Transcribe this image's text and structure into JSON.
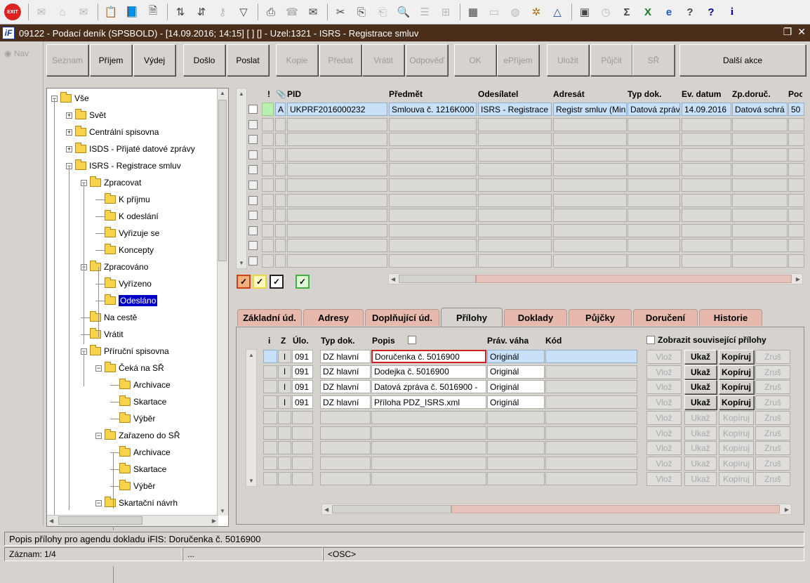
{
  "toolbar": {
    "exit_label": "EXIT",
    "icons": [
      "mail-send-icon",
      "home-icon",
      "mail-reply-icon",
      "clipboard-icon",
      "book-icon",
      "delete-doc-icon",
      "sort-az-icon",
      "sort-za-icon",
      "key-icon",
      "filter-icon",
      "printer-icon",
      "fax-icon",
      "mail-icon",
      "scissors-icon",
      "copy-icon",
      "paste-icon",
      "search-icon",
      "list-icon",
      "tree-icon",
      "calc-icon",
      "page-icon",
      "globe-icon",
      "gear-icon",
      "triangle-icon",
      "image-icon",
      "clock-icon",
      "sum-icon",
      "excel-icon",
      "ie-icon",
      "help-icon",
      "help-box-icon",
      "info-icon"
    ],
    "sum_glyph": "Σ",
    "help_glyph": "?",
    "info_glyph": "i"
  },
  "window": {
    "title": "09122 - Podací deník (SPSBOLD) - [14.09.2016; 14:15] [ ] [] - Uzel:1321 - ISRS - Registrace smluv",
    "logo": "iF"
  },
  "nav": {
    "label": "Nav"
  },
  "action_buttons": [
    {
      "label": "Seznam",
      "enabled": false
    },
    {
      "label": "Příjem",
      "enabled": true
    },
    {
      "label": "Výdej",
      "enabled": true
    },
    {
      "label": "Došlo",
      "enabled": true
    },
    {
      "label": "Poslat",
      "enabled": true
    },
    {
      "label": "Kopie",
      "enabled": false
    },
    {
      "label": "Předat",
      "enabled": false
    },
    {
      "label": "Vrátit",
      "enabled": false
    },
    {
      "label": "Odpověď",
      "enabled": false
    },
    {
      "label": "OK",
      "enabled": false
    },
    {
      "label": "ePříjem",
      "enabled": false
    },
    {
      "label": "Uložit",
      "enabled": false
    },
    {
      "label": "Půjčit",
      "enabled": false
    },
    {
      "label": "SŘ",
      "enabled": false
    },
    {
      "label": "Další akce",
      "enabled": true
    }
  ],
  "tree": [
    {
      "label": "Vše",
      "level": 0,
      "expander": "−"
    },
    {
      "label": "Svět",
      "level": 1,
      "expander": "+"
    },
    {
      "label": "Centrální spisovna",
      "level": 1,
      "expander": "+"
    },
    {
      "label": "ISDS - Přijaté datové zprávy",
      "level": 1,
      "expander": "+"
    },
    {
      "label": "ISRS - Registrace smluv",
      "level": 1,
      "expander": "−"
    },
    {
      "label": "Zpracovat",
      "level": 2,
      "expander": "−"
    },
    {
      "label": "K příjmu",
      "level": 3,
      "expander": ""
    },
    {
      "label": "K odeslání",
      "level": 3,
      "expander": ""
    },
    {
      "label": "Vyřizuje se",
      "level": 3,
      "expander": ""
    },
    {
      "label": "Koncepty",
      "level": 3,
      "expander": ""
    },
    {
      "label": "Zpracováno",
      "level": 2,
      "expander": "−"
    },
    {
      "label": "Vyřízeno",
      "level": 3,
      "expander": ""
    },
    {
      "label": "Odesláno",
      "level": 3,
      "expander": "",
      "selected": true
    },
    {
      "label": "Na cestě",
      "level": 2,
      "expander": ""
    },
    {
      "label": "Vrátit",
      "level": 2,
      "expander": ""
    },
    {
      "label": "Příruční spisovna",
      "level": 2,
      "expander": "−"
    },
    {
      "label": "Čeká na SŘ",
      "level": 3,
      "expander": "−"
    },
    {
      "label": "Archivace",
      "level": 4,
      "expander": ""
    },
    {
      "label": "Skartace",
      "level": 4,
      "expander": ""
    },
    {
      "label": "Výběr",
      "level": 4,
      "expander": ""
    },
    {
      "label": "Zařazeno do SŘ",
      "level": 3,
      "expander": "−"
    },
    {
      "label": "Archivace",
      "level": 4,
      "expander": ""
    },
    {
      "label": "Skartace",
      "level": 4,
      "expander": ""
    },
    {
      "label": "Výběr",
      "level": 4,
      "expander": ""
    },
    {
      "label": "Skartační návrh",
      "level": 3,
      "expander": "−"
    }
  ],
  "doc_grid": {
    "headers": [
      "!",
      "📎",
      "PID",
      "Předmět",
      "Odesílatel",
      "Adresát",
      "Typ dok.",
      "Ev. datum",
      "Zp.doruč.",
      "Poc"
    ],
    "rows": [
      [
        "",
        "A",
        "UKPRF2016000232",
        "Smlouva č. 1216K000",
        "ISRS - Registrace",
        "Registr smluv (Min",
        "Datová zpráv",
        "14.09.2016",
        "Datová schrá",
        "50"
      ]
    ],
    "empty_rows": 10
  },
  "filter_boxes": [
    {
      "color": "#d04010",
      "mark": "✓"
    },
    {
      "color": "#e8d840",
      "mark": "✓"
    },
    {
      "color": "#202020",
      "mark": "✓"
    },
    {
      "color": "#40b040",
      "mark": "✓"
    }
  ],
  "tabs": [
    {
      "label": "Základní úd.",
      "active": false
    },
    {
      "label": "Adresy",
      "active": false
    },
    {
      "label": "Doplňující úd.",
      "active": false
    },
    {
      "label": "Přílohy",
      "active": true
    },
    {
      "label": "Doklady",
      "active": false
    },
    {
      "label": "Půjčky",
      "active": false
    },
    {
      "label": "Doručení",
      "active": false
    },
    {
      "label": "Historie",
      "active": false
    }
  ],
  "attachments": {
    "headers": [
      "i",
      "Z",
      "Úlo.",
      "Typ dok.",
      "Popis",
      "Práv. váha",
      "Kód"
    ],
    "show_related_label": "Zobrazit související přílohy",
    "rows": [
      {
        "z": "I",
        "ulo": "091",
        "typ": "DZ hlavní",
        "popis": "Doručenka č. 5016900",
        "vaha": "Originál",
        "kod": ""
      },
      {
        "z": "I",
        "ulo": "091",
        "typ": "DZ hlavní",
        "popis": "Dodejka č. 5016900",
        "vaha": "Originál",
        "kod": ""
      },
      {
        "z": "I",
        "ulo": "091",
        "typ": "DZ hlavní",
        "popis": "Datová zpráva č. 5016900 -",
        "vaha": "Originál",
        "kod": ""
      },
      {
        "z": "I",
        "ulo": "091",
        "typ": "DZ hlavní",
        "popis": "Příloha PDZ_ISRS.xml",
        "vaha": "Originál",
        "kod": ""
      }
    ],
    "empty_rows": 5,
    "row_buttons": [
      "Vlož",
      "Ukaž",
      "Kopíruj",
      "Zruš"
    ]
  },
  "status": {
    "message": "Popis přílohy pro agendu dokladu iFIS: Doručenka č. 5016900",
    "record": "Záznam: 1/4",
    "field2": "...",
    "osc": "<OSC>"
  }
}
